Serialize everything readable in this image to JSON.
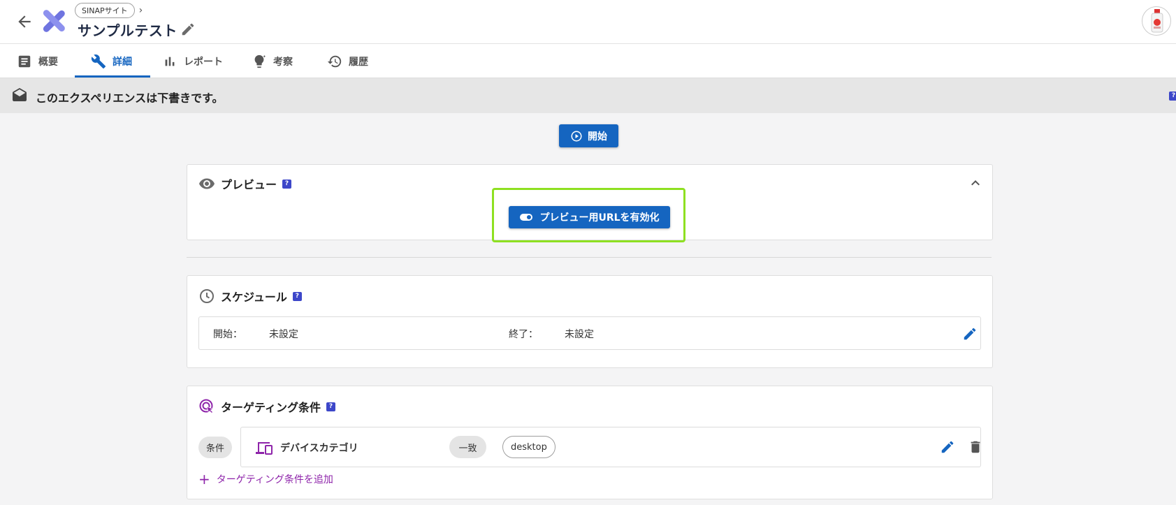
{
  "header": {
    "breadcrumb": "SINAPサイト",
    "title": "サンプルテスト"
  },
  "tabs": [
    {
      "label": "概要",
      "icon": "document-icon"
    },
    {
      "label": "詳細",
      "icon": "wrench-icon",
      "active": true
    },
    {
      "label": "レポート",
      "icon": "bar-chart-icon"
    },
    {
      "label": "考察",
      "icon": "lightbulb-icon"
    },
    {
      "label": "履歴",
      "icon": "history-icon"
    }
  ],
  "banner": {
    "text": "このエクスペリエンスは下書きです。",
    "help": "?"
  },
  "start_button": {
    "label": "開始"
  },
  "preview": {
    "title": "プレビュー",
    "help": "?",
    "enable_button": "プレビュー用URLを有効化"
  },
  "schedule": {
    "title": "スケジュール",
    "help": "?",
    "start_label": "開始：",
    "start_value": "未設定",
    "end_label": "終了：",
    "end_value": "未設定"
  },
  "targeting": {
    "title": "ターゲティング条件",
    "help": "?",
    "condition_chip": "条件",
    "condition": {
      "field": "デバイスカテゴリ",
      "operator": "一致",
      "value": "desktop"
    },
    "add_label": "ターゲティング条件を追加"
  },
  "colors": {
    "primary": "#1565c0",
    "highlight": "#8ee021",
    "accent_purple": "#8e24aa",
    "help_badge": "#3d47c9"
  }
}
